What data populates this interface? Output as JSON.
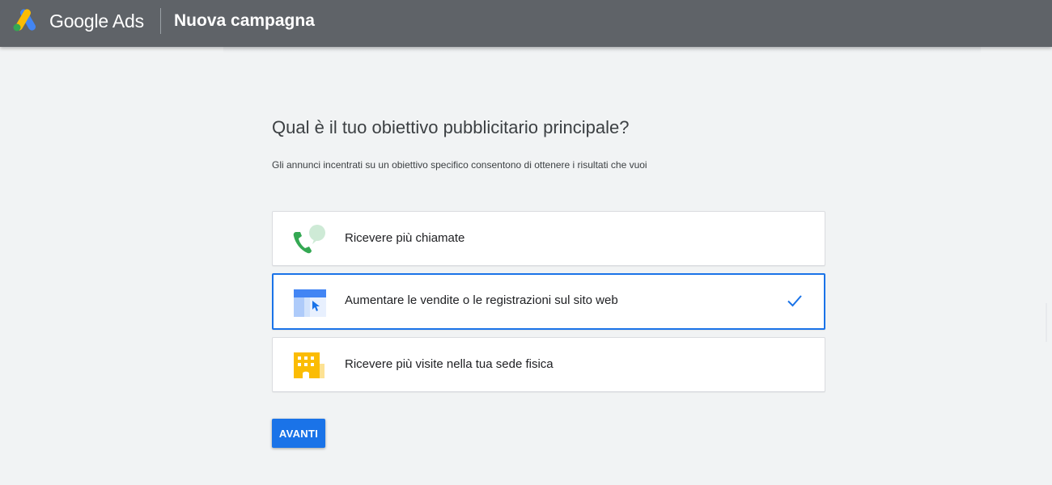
{
  "header": {
    "brand": "Google Ads",
    "title": "Nuova campagna",
    "background": "#5f6368",
    "logo_icon": "google-ads-logo"
  },
  "main": {
    "question": "Qual è il tuo obiettivo pubblicitario principale?",
    "subtitle": "Gli annunci incentrati su un obiettivo specifico consentono di ottenere i risultati che vuoi",
    "options": [
      {
        "label": "Ricevere più chiamate",
        "icon": "phone-call-icon",
        "selected": false
      },
      {
        "label": "Aumentare le vendite o le registrazioni sul sito web",
        "icon": "website-icon",
        "selected": true
      },
      {
        "label": "Ricevere più visite nella tua sede fisica",
        "icon": "storefront-icon",
        "selected": false
      }
    ],
    "next_label": "AVANTI"
  },
  "colors": {
    "accent": "#1a73e8",
    "page_background": "#f1f3f4",
    "phone_green": "#34a853",
    "store_yellow": "#fbbc04"
  }
}
